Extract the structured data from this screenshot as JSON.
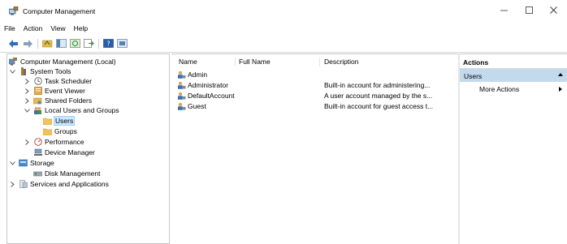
{
  "window": {
    "title": "Computer Management",
    "controls": [
      "minimize",
      "maximize",
      "close"
    ]
  },
  "menu": [
    "File",
    "Action",
    "View",
    "Help"
  ],
  "toolbar": [
    "back-arrow-icon",
    "forward-arrow-icon",
    "up-folder-icon",
    "show-hide-console-tree-icon",
    "refresh-icon",
    "export-list-icon",
    "help-icon",
    "properties-icon"
  ],
  "tree": {
    "root": "Computer Management (Local)",
    "items": [
      {
        "label": "System Tools",
        "level": 1,
        "expanded": true
      },
      {
        "label": "Task Scheduler",
        "level": 2,
        "expanded": false
      },
      {
        "label": "Event Viewer",
        "level": 2,
        "expanded": false
      },
      {
        "label": "Shared Folders",
        "level": 2,
        "expanded": false
      },
      {
        "label": "Local Users and Groups",
        "level": 2,
        "expanded": true
      },
      {
        "label": "Users",
        "level": 3,
        "selected": true
      },
      {
        "label": "Groups",
        "level": 3
      },
      {
        "label": "Performance",
        "level": 2,
        "expanded": false
      },
      {
        "label": "Device Manager",
        "level": 2
      },
      {
        "label": "Storage",
        "level": 1,
        "expanded": true
      },
      {
        "label": "Disk Management",
        "level": 2
      },
      {
        "label": "Services and Applications",
        "level": 1,
        "expanded": false
      }
    ]
  },
  "list": {
    "columns": [
      "Name",
      "Full Name",
      "Description"
    ],
    "rows": [
      {
        "name": "Admin",
        "full_name": "",
        "description": ""
      },
      {
        "name": "Administrator",
        "full_name": "",
        "description": "Built-in account for administering..."
      },
      {
        "name": "DefaultAccount",
        "full_name": "",
        "description": "A user account managed by the s..."
      },
      {
        "name": "Guest",
        "full_name": "",
        "description": "Built-in account for guest access t..."
      }
    ]
  },
  "actions": {
    "title": "Actions",
    "section": "Users",
    "items": [
      "More Actions"
    ]
  },
  "colors": {
    "selection": "#cce8ff",
    "actions_header": "#c3d9ee"
  }
}
